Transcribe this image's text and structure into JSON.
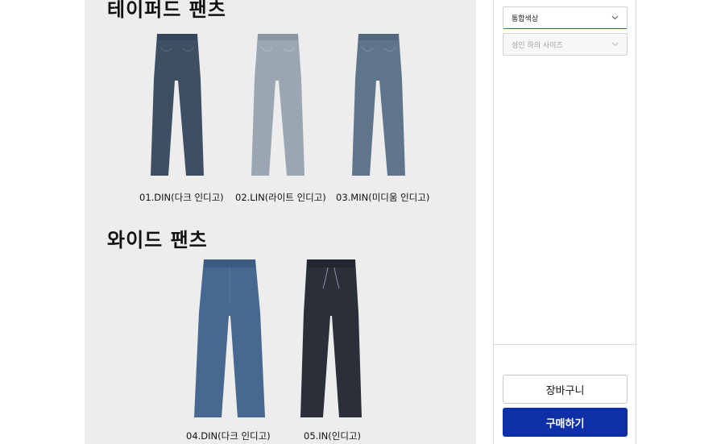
{
  "product_images": {
    "tapered_title": "테이퍼드 팬츠",
    "wide_title": "와이드 팬츠",
    "items": [
      {
        "label": "01.DIN(다크 인디고)",
        "color": "#3e4f63"
      },
      {
        "label": "02.LIN(라이트 인디고)",
        "color": "#9aa6b2"
      },
      {
        "label": "03.MIN(미디움 인디고)",
        "color": "#60758b"
      },
      {
        "label": "04.DIN(다크 인디고)",
        "color": "#47688f"
      },
      {
        "label": "05.IN(인디고)",
        "color": "#2a2f3a"
      }
    ]
  },
  "options": {
    "color_select_value": "통합색상",
    "size_select_placeholder": "성인 하의 사이즈"
  },
  "buttons": {
    "cart_label": "장바구니",
    "buy_label": "구매하기"
  },
  "colors": {
    "buy_button": "#0d2fa8",
    "panel_bg": "#ededed"
  }
}
